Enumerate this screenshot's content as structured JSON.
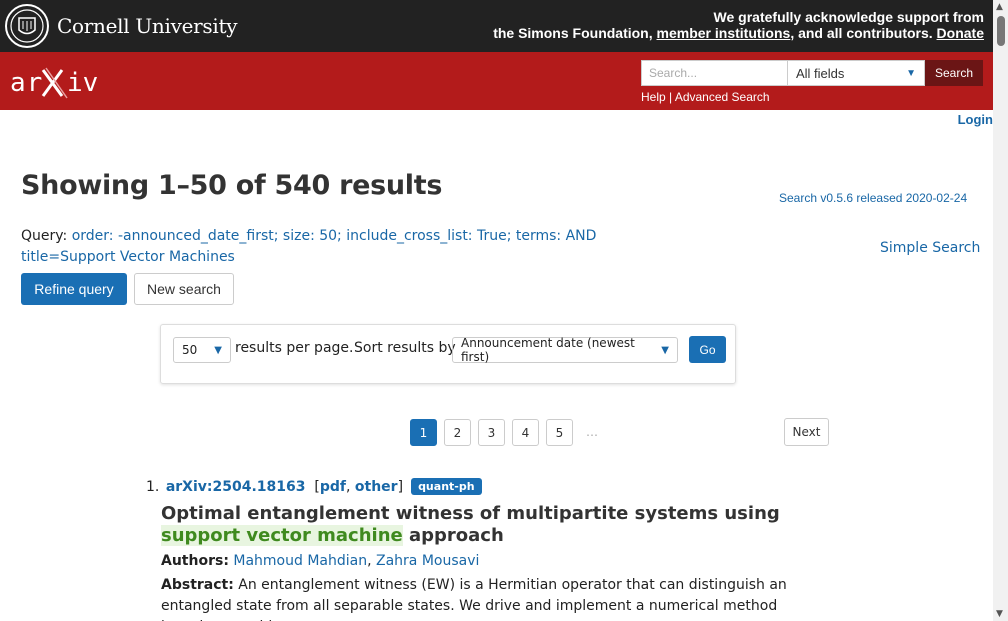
{
  "topbar": {
    "cornell_name": "Cornell University",
    "support_line1": "We gratefully acknowledge support from",
    "support_line2_prefix": "the Simons Foundation, ",
    "member_institutions": "member institutions",
    "support_line2_mid": ", and all contributors. ",
    "donate": "Donate"
  },
  "header": {
    "logo_text": "arXiv",
    "search_placeholder": "Search...",
    "field_selected": "All fields",
    "search_button": "Search",
    "help": "Help",
    "separator": " | ",
    "advanced_search": "Advanced Search"
  },
  "login": "Login",
  "page": {
    "title": "Showing 1–50 of 540 results",
    "version": "Search v0.5.6 released 2020-02-24",
    "query_label": "Query: ",
    "query_text": "order: -announced_date_first; size: 50; include_cross_list: True; terms: AND title=Support Vector Machines",
    "simple_search": "Simple Search",
    "refine_button": "Refine query",
    "new_search_button": "New search"
  },
  "controls": {
    "size_selected": "50",
    "results_per_page": "results per page.",
    "sort_label": "Sort results by",
    "sort_selected": "Announcement date (newest first)",
    "go_button": "Go"
  },
  "pagination": {
    "pages": [
      "1",
      "2",
      "3",
      "4",
      "5"
    ],
    "active_page": "1",
    "ellipsis": "…",
    "next": "Next"
  },
  "results": [
    {
      "number": "1.",
      "id": "arXiv:2504.18163",
      "pdf": "pdf",
      "other": "other",
      "category": "quant-ph",
      "title_before": "Optimal entanglement witness of multipartite systems using ",
      "title_highlight": "support vector machine",
      "title_after": " approach",
      "authors_label": "Authors:",
      "authors": [
        "Mahmoud Mahdian",
        "Zahra Mousavi"
      ],
      "abstract_label": "Abstract:",
      "abstract": "An entanglement witness (EW) is a Hermitian operator that can distinguish an entangled state from all separable states. We drive and implement a numerical method based on machine"
    }
  ],
  "colors": {
    "arxiv_red": "#b31b1b",
    "link_blue": "#1967a6",
    "button_blue": "#1a6fb4",
    "highlight_green": "#3f8a1f"
  }
}
